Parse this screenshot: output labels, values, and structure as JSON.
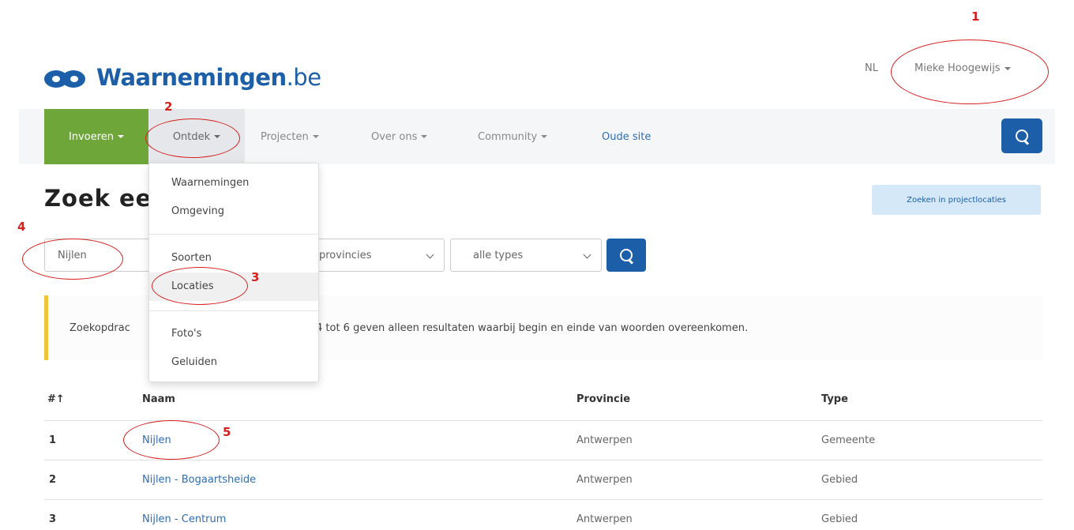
{
  "header": {
    "logo_main": "Waarnemingen",
    "logo_suffix": ".be",
    "lang": "NL",
    "user": "Mieke Hoogewijs"
  },
  "nav": {
    "items": [
      {
        "label": "Invoeren",
        "dropdown": true
      },
      {
        "label": "Ontdek",
        "dropdown": true
      },
      {
        "label": "Projecten",
        "dropdown": true
      },
      {
        "label": "Over ons",
        "dropdown": true
      },
      {
        "label": "Community",
        "dropdown": true
      },
      {
        "label": "Oude site",
        "dropdown": false
      }
    ]
  },
  "dropdown": {
    "items": [
      "Waarnemingen",
      "Omgeving",
      "Soorten",
      "Locaties",
      "Foto's",
      "Geluiden"
    ]
  },
  "page": {
    "title": "Zoek ee",
    "project_button": "Zoeken in projectlocaties"
  },
  "search": {
    "name_value": "Nijlen",
    "province_value": "provincies",
    "type_value": "alle types"
  },
  "alert": {
    "text_start": "Zoekopdrac",
    "text_end": "4 tot 6 geven alleen resultaten waarbij begin en einde van woorden overeenkomen."
  },
  "table": {
    "headers": [
      "#↑",
      "Naam",
      "Provincie",
      "Type"
    ],
    "rows": [
      {
        "num": "1",
        "name": "Nijlen",
        "province": "Antwerpen",
        "type": "Gemeente"
      },
      {
        "num": "2",
        "name": "Nijlen - Bogaartsheide",
        "province": "Antwerpen",
        "type": "Gebied"
      },
      {
        "num": "3",
        "name": "Nijlen - Centrum",
        "province": "Antwerpen",
        "type": "Gebied"
      }
    ]
  },
  "annotations": [
    "1",
    "2",
    "3",
    "4",
    "5"
  ],
  "colors": {
    "brand_blue": "#1c5fa8",
    "invoeren_green": "#6fa63a",
    "annotation_red": "#d62020",
    "alert_yellow": "#f0c43b"
  }
}
